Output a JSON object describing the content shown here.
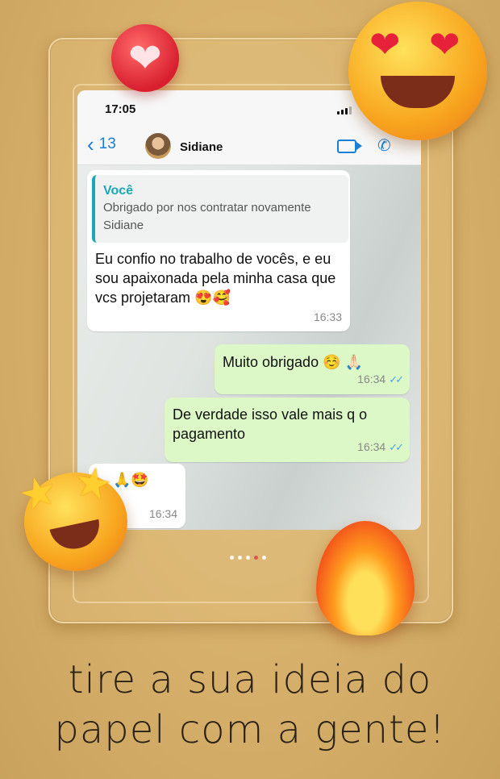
{
  "status_bar": {
    "time": "17:05"
  },
  "chat_header": {
    "back_count": "13",
    "contact_name": "Sidiane"
  },
  "messages": [
    {
      "direction": "in",
      "quoted_author": "Você",
      "quoted_text": "Obrigado por nos contratar novamente Sidiane",
      "text": "Eu confio no trabalho de vocês, e eu sou apaixonada pela minha casa que vcs projetaram 😍🥰",
      "time": "16:33"
    },
    {
      "direction": "out",
      "text": "Muito obrigado ☺️ 🙏🏻",
      "time": "16:34"
    },
    {
      "direction": "out",
      "text": "De verdade isso vale mais q o pagamento",
      "time": "16:34"
    },
    {
      "direction": "in",
      "text": "🙏🤩",
      "time": "16:34"
    }
  ],
  "stickers": {
    "heart": "❤",
    "love_face": "heart-eyes-emoji",
    "star_face": "star-struck-emoji",
    "fire": "fire-emoji"
  },
  "caption": {
    "line1": "tire a sua ideia do",
    "line2": "papel com a gente!"
  },
  "colors": {
    "accent": "#1a7fd4",
    "outgoing_bubble": "#dcf8c6",
    "quote_bar": "#1aa9b4"
  }
}
